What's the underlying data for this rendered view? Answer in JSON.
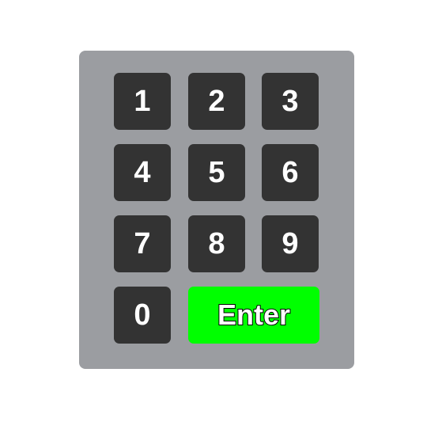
{
  "keypad": {
    "keys": [
      {
        "label": "1",
        "name": "key-1"
      },
      {
        "label": "2",
        "name": "key-2"
      },
      {
        "label": "3",
        "name": "key-3"
      },
      {
        "label": "4",
        "name": "key-4"
      },
      {
        "label": "5",
        "name": "key-5"
      },
      {
        "label": "6",
        "name": "key-6"
      },
      {
        "label": "7",
        "name": "key-7"
      },
      {
        "label": "8",
        "name": "key-8"
      },
      {
        "label": "9",
        "name": "key-9"
      },
      {
        "label": "0",
        "name": "key-0"
      }
    ],
    "enter_label": "Enter",
    "colors": {
      "panel": "#9b9da1",
      "key": "#333333",
      "enter": "#00ff00",
      "key_text": "#ffffff"
    }
  }
}
